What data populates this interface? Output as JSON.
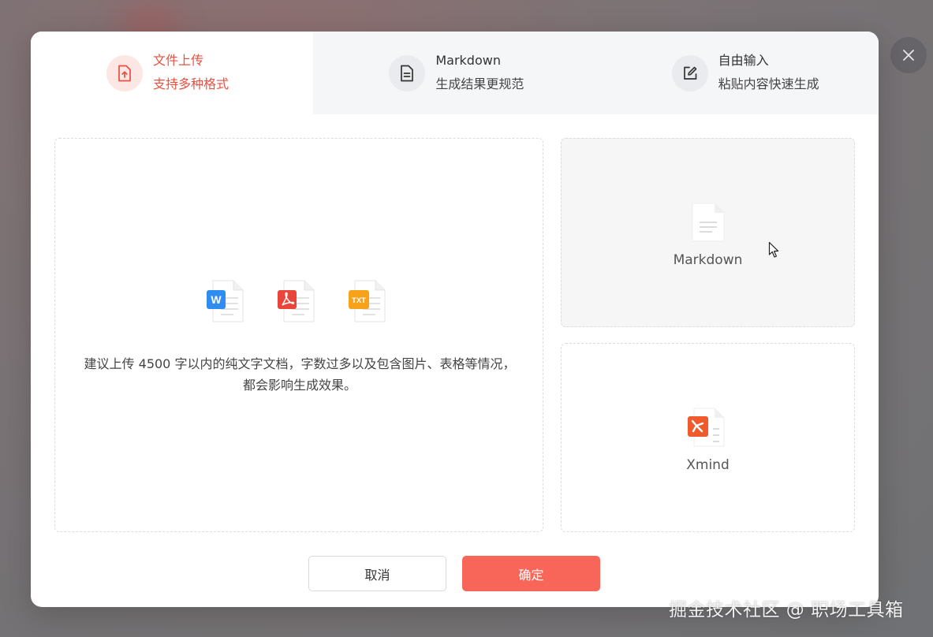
{
  "tabs": [
    {
      "title": "文件上传",
      "subtitle": "支持多种格式",
      "icon": "upload-file-icon",
      "active": true
    },
    {
      "title": "Markdown",
      "subtitle": "生成结果更规范",
      "icon": "document-lines-icon",
      "active": false
    },
    {
      "title": "自由输入",
      "subtitle": "粘贴内容快速生成",
      "icon": "edit-icon",
      "active": false
    }
  ],
  "upload": {
    "file_types": [
      "W",
      "PDF",
      "TXT"
    ],
    "hint": "建议上传 4500 字以内的纯文字文档，字数过多以及包含图片、表格等情况，都会影响生成效果。"
  },
  "formats": [
    {
      "label": "Markdown",
      "selected": true
    },
    {
      "label": "Xmind",
      "selected": false
    }
  ],
  "buttons": {
    "cancel": "取消",
    "confirm": "确定"
  },
  "watermark": "掘金技术社区 @ 职场工具箱",
  "colors": {
    "accent": "#f76659",
    "active_text": "#e8503f",
    "word": "#2f8cf0",
    "pdf": "#e9453a",
    "txt": "#f7a21b",
    "xmind": "#ef5b2c"
  }
}
